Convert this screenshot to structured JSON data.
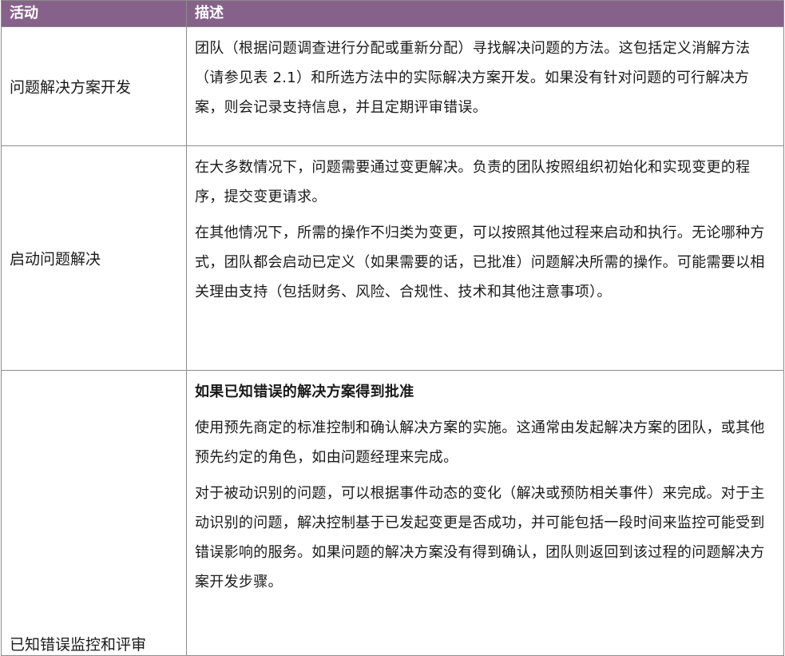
{
  "header": {
    "activity": "活动",
    "description": "描述"
  },
  "rows": [
    {
      "activity": "问题解决方案开发",
      "paragraphs": [
        "团队（根据问题调查进行分配或重新分配）寻找解决问题的方法。这包括定义消解方法（请参见表 2.1）和所选方法中的实际解决方案开发。如果没有针对问题的可行解决方案，则会记录支持信息，并且定期评审错误。"
      ]
    },
    {
      "activity": "启动问题解决",
      "paragraphs": [
        "在大多数情况下，问题需要通过变更解决。负责的团队按照组织初始化和实现变更的程序，提交变更请求。",
        "在其他情况下，所需的操作不归类为变更，可以按照其他过程来启动和执行。无论哪种方式，团队都会启动已定义（如果需要的话，已批准）问题解决所需的操作。可能需要以相关理由支持（包括财务、风险、合规性、技术和其他注意事项）。"
      ]
    },
    {
      "activity": "已知错误监控和评审",
      "heading": "如果已知错误的解决方案得到批准",
      "paragraphs": [
        "使用预先商定的标准控制和确认解决方案的实施。这通常由发起解决方案的团队，或其他预先约定的角色，如由问题经理来完成。",
        "对于被动识别的问题，可以根据事件动态的变化（解决或预防相关事件）来完成。对于主动识别的问题，解决控制基于已发起变更是否成功，并可能包括一段时间来监控可能受到错误影响的服务。如果问题的解决方案没有得到确认，团队则返回到该过程的问题解决方案开发步骤。"
      ]
    }
  ]
}
